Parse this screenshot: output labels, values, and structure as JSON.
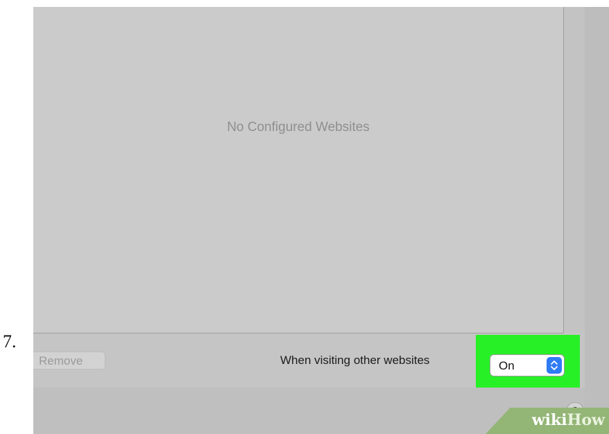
{
  "step": {
    "number": "7."
  },
  "websites_list": {
    "empty_text": "No Configured Websites"
  },
  "bottom_bar": {
    "remove_label": "Remove",
    "visiting_label": "When visiting other websites",
    "popup_value": "On"
  },
  "help": {
    "label": "?"
  },
  "watermark": {
    "wiki": "wiki",
    "how": "How"
  },
  "colors": {
    "highlight": "#27f027",
    "popup_accent": "#2f7bf5",
    "watermark_bg": "#93b576"
  },
  "icons": {
    "popup_arrow": "chevron-updown-icon",
    "help": "question-icon"
  }
}
